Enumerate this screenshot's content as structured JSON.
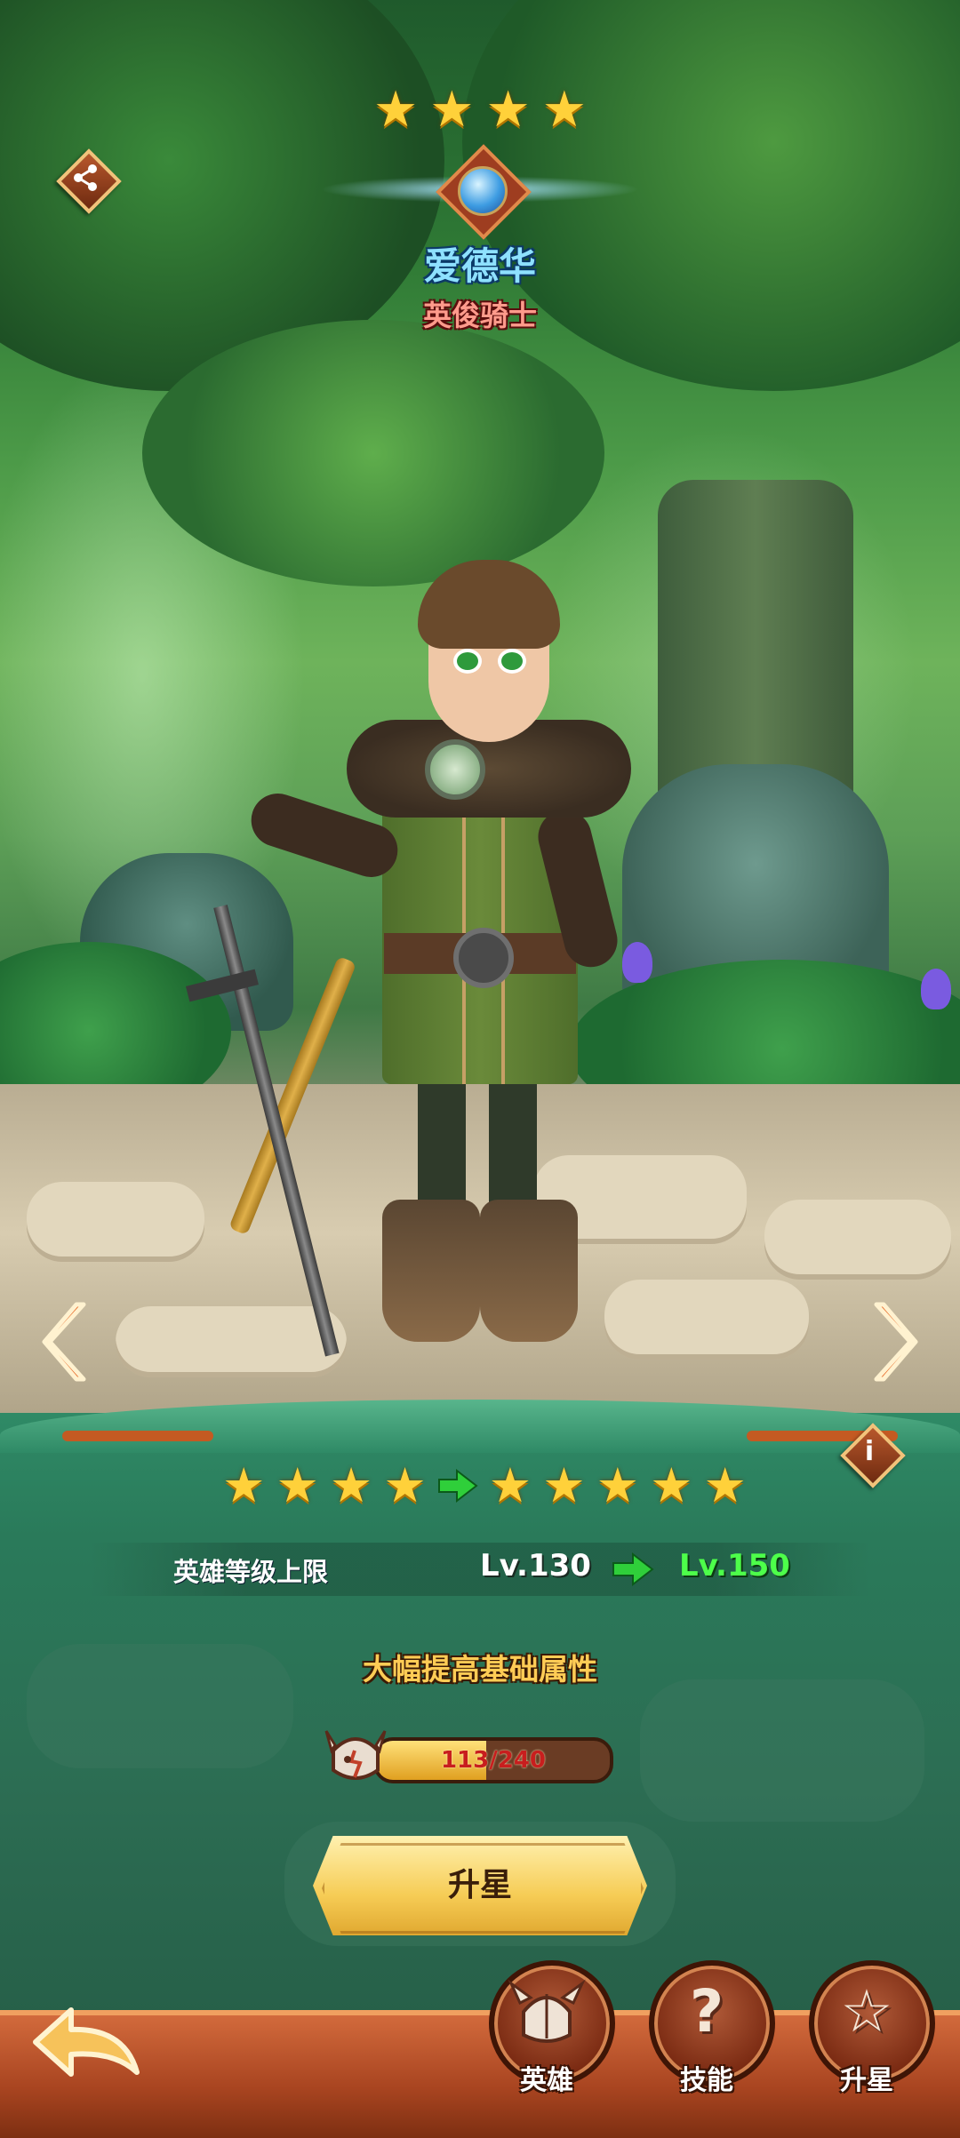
{
  "hero": {
    "name": "爱德华",
    "title": "英俊骑士",
    "current_stars": 4,
    "element_icon": "blue-gem-icon"
  },
  "header": {
    "share_icon": "share-icon"
  },
  "navigation": {
    "prev_icon": "chevron-left-icon",
    "next_icon": "chevron-right-icon",
    "info_label": "i"
  },
  "star_upgrade": {
    "from_stars": 4,
    "to_stars": 5,
    "level_cap_label": "英雄等级上限",
    "level_from": "Lv.130",
    "level_to": "Lv.150",
    "bonus_text": "大幅提高基础属性",
    "shard_progress_text": "113/240",
    "shard_progress": 0.4708,
    "button_label": "升星"
  },
  "bottom_bar": {
    "back_icon": "back-arrow-icon",
    "tabs": [
      {
        "label": "英雄",
        "icon": "helmet-icon"
      },
      {
        "label": "技能",
        "icon": "question-icon"
      },
      {
        "label": "升星",
        "icon": "star-icon"
      }
    ]
  },
  "colors": {
    "star": "#ffd13a",
    "level_to": "#4dff4a",
    "hero_name": "#8ee1ff",
    "hero_title": "#ff9b8c",
    "progress_text": "#c81e1e",
    "button": "#f6cc55"
  }
}
